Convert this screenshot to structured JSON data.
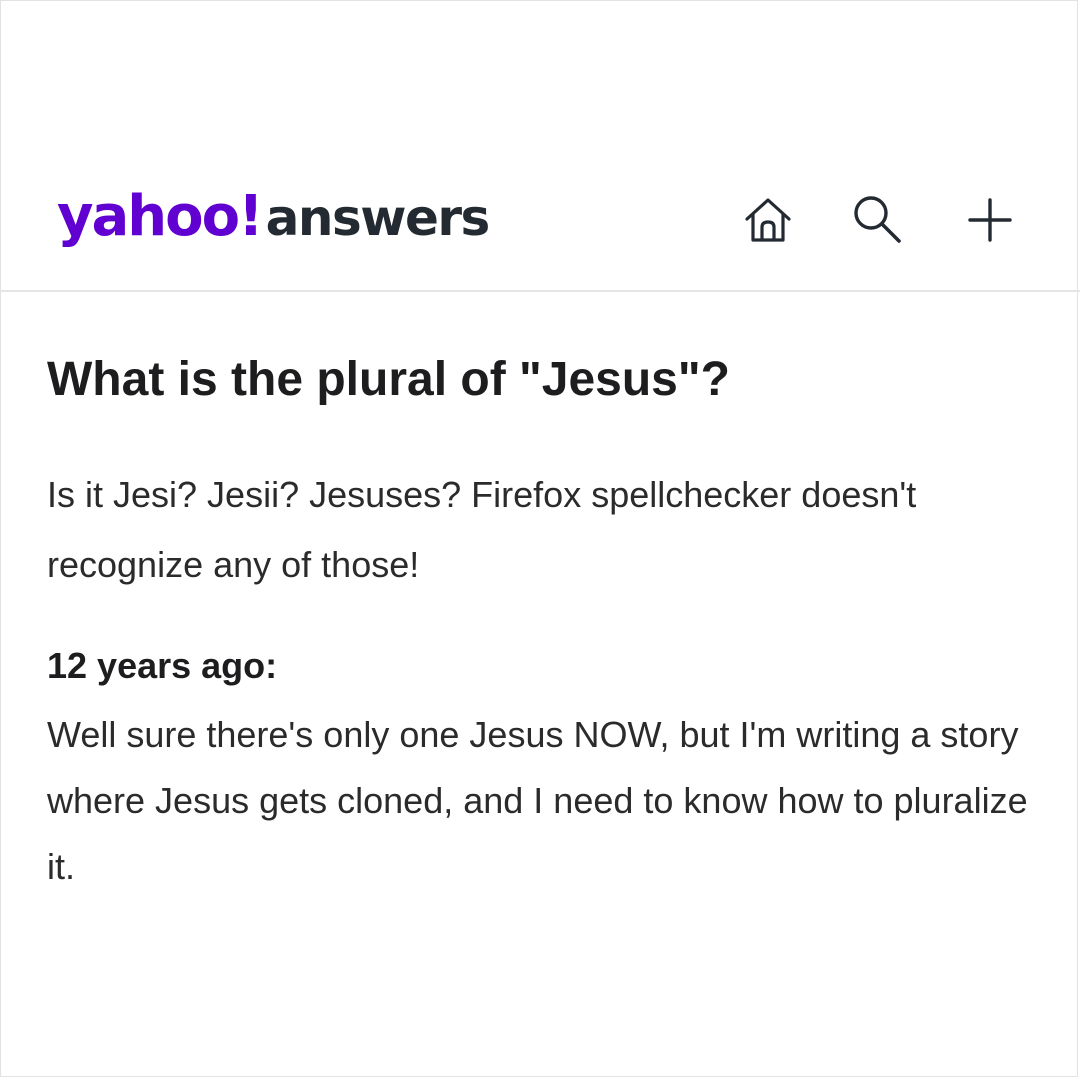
{
  "header": {
    "logo": {
      "brand": "yahoo!",
      "product": "answers"
    },
    "icons": {
      "home": "home-icon",
      "search": "search-icon",
      "add": "plus-icon"
    },
    "accent_color": "#6001d2"
  },
  "question": {
    "title": "What is the plural of \"Jesus\"?",
    "details": "Is it Jesi? Jesii? Jesuses? Firefox spellchecker doesn't recognize any of those!"
  },
  "answer": {
    "time": "12 years ago:",
    "text": "Well sure there's only one Jesus NOW, but I'm writing a story where Jesus gets cloned, and I need to know how to pluralize it."
  }
}
